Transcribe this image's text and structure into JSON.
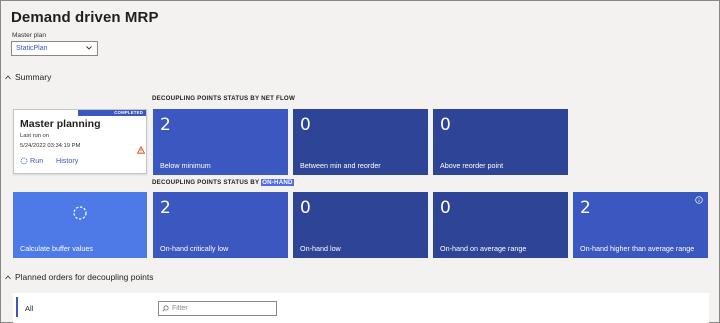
{
  "page": {
    "title": "Demand driven MRP"
  },
  "master_plan": {
    "label": "Master plan",
    "value": "StaticPlan"
  },
  "summary": {
    "header": "Summary"
  },
  "net_flow_group": {
    "label": "DECOUPLING POINTS STATUS BY NET FLOW"
  },
  "on_hand_group": {
    "label_prefix": "DECOUPLING POINTS STATUS BY",
    "label_highlight": "ON-HAND"
  },
  "master_planning": {
    "badge": "COMPLETED",
    "title": "Master planning",
    "last_run_label": "Last run on",
    "last_run_date": "5/24/2022 03:34:19 PM",
    "run_label": "Run",
    "history_label": "History"
  },
  "calculate_tile": {
    "label": "Calculate buffer values"
  },
  "net_flow_cards": [
    {
      "value": "2",
      "label": "Below minimum"
    },
    {
      "value": "0",
      "label": "Between min and reorder"
    },
    {
      "value": "0",
      "label": "Above reorder point"
    }
  ],
  "on_hand_cards": [
    {
      "value": "2",
      "label": "On-hand critically low"
    },
    {
      "value": "0",
      "label": "On-hand low"
    },
    {
      "value": "0",
      "label": "On-hand on average range"
    },
    {
      "value": "2",
      "label": "On-hand higher than average range"
    }
  ],
  "planned_orders": {
    "header": "Planned orders for decoupling points",
    "list_item": "All",
    "filter_placeholder": "Filter"
  },
  "colors": {
    "accent": "#3b57c0",
    "tile_dark": "#2e4496",
    "tile_light": "#4e7ae8",
    "warning": "#d83b01"
  }
}
